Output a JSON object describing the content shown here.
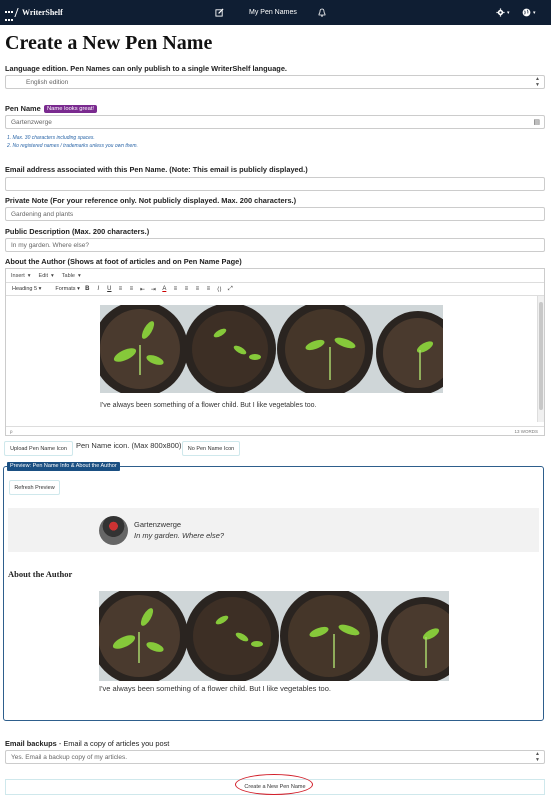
{
  "nav": {
    "brand": "WriterShelf",
    "my_pen_names": "My Pen Names",
    "gear_caret": "▾",
    "globe_caret": "▾"
  },
  "page_title": "Create a New Pen Name",
  "language": {
    "label": "Language edition. Pen Names can only publish to a single WriterShelf language.",
    "value": "English edition"
  },
  "pen_name": {
    "label": "Pen Name",
    "badge": "Name looks great!",
    "value": "Gartenzwerge",
    "hint1": "1. Max. 30 characters including spaces.",
    "hint2": "2. No registered names / trademarks unless you own them."
  },
  "email": {
    "label": "Email address associated with this Pen Name. (Note: This email is publicly displayed.)",
    "value": ""
  },
  "private_note": {
    "label": "Private Note (For your reference only. Not publicly displayed. Max. 200 characters.)",
    "value": "Gardening and plants"
  },
  "public_description": {
    "label": "Public Description (Max. 200 characters.)",
    "value": "In my garden. Where else?"
  },
  "about_author": {
    "label": "About the Author (Shows at foot of articles and on Pen Name Page)",
    "menu": [
      "Insert",
      "Edit",
      "Table"
    ],
    "format_select": "Heading 5",
    "formats": "Formats",
    "toolbar_buttons": [
      "B",
      "I",
      "U",
      "≡",
      "≡",
      "⇤",
      "⇥",
      "A",
      "≡",
      "≡",
      "≡",
      "≡",
      "⟨⟩",
      "⤢"
    ],
    "content_text": "I've always been something of a flower child.  But I like vegetables too.",
    "status_path": "p",
    "word_count": "13 WORDS"
  },
  "icon": {
    "upload_label": "Upload Pen Name Icon",
    "note": "Pen Name icon. (Max 800x800)",
    "no_icon_label": "No Pen Name Icon"
  },
  "preview": {
    "tab_label": "Preview: Pen Name Info & About the Author",
    "refresh_label": "Refresh Preview",
    "name": "Gartenzwerge",
    "description": "In my garden. Where else?",
    "about_heading": "About the Author",
    "about_text": "I've always been something of a flower child.  But I like vegetables too."
  },
  "backups": {
    "label": "Email backups",
    "sublabel": " - Email a copy of articles you post",
    "value": "Yes. Email a backup copy of my articles."
  },
  "submit": {
    "label": "Create a New Pen Name"
  },
  "colors": {
    "nav_bg": "#0f1e33",
    "badge": "#7a2a8f",
    "preview_border": "#2e5e8c",
    "highlight_circle": "#d21f2a"
  }
}
